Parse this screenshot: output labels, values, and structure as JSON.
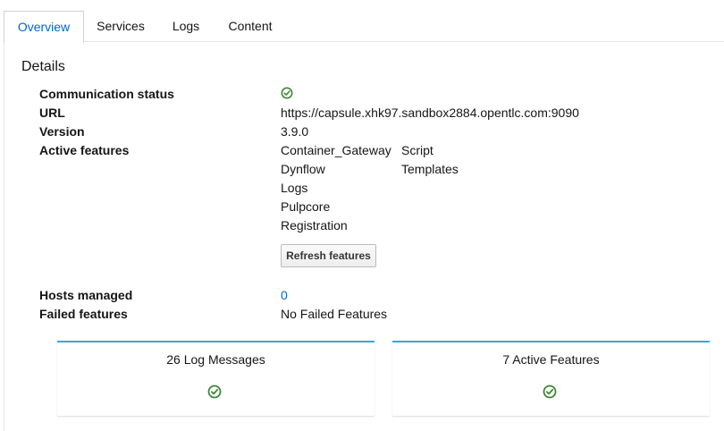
{
  "tabs": [
    {
      "label": "Overview",
      "active": true
    },
    {
      "label": "Services",
      "active": false
    },
    {
      "label": "Logs",
      "active": false
    },
    {
      "label": "Content",
      "active": false
    }
  ],
  "details": {
    "title": "Details",
    "communication_status_label": "Communication status",
    "url_label": "URL",
    "url_value": "https://capsule.xhk97.sandbox2884.opentlc.com:9090",
    "version_label": "Version",
    "version_value": "3.9.0",
    "active_features_label": "Active features",
    "features_col1": [
      "Container_Gateway",
      "Dynflow",
      "Logs",
      "Pulpcore",
      "Registration"
    ],
    "features_col2": [
      "Script",
      "Templates"
    ],
    "refresh_button": "Refresh features",
    "hosts_managed_label": "Hosts managed",
    "hosts_managed_value": "0",
    "failed_features_label": "Failed features",
    "failed_features_value": "No Failed Features"
  },
  "cards": [
    {
      "title": "26 Log Messages",
      "status_icon": "check-circle-icon"
    },
    {
      "title": "7 Active Features",
      "status_icon": "check-circle-icon"
    }
  ],
  "colors": {
    "accent": "#0066cc",
    "success": "#3e8635",
    "card_border": "#39a5dc"
  }
}
